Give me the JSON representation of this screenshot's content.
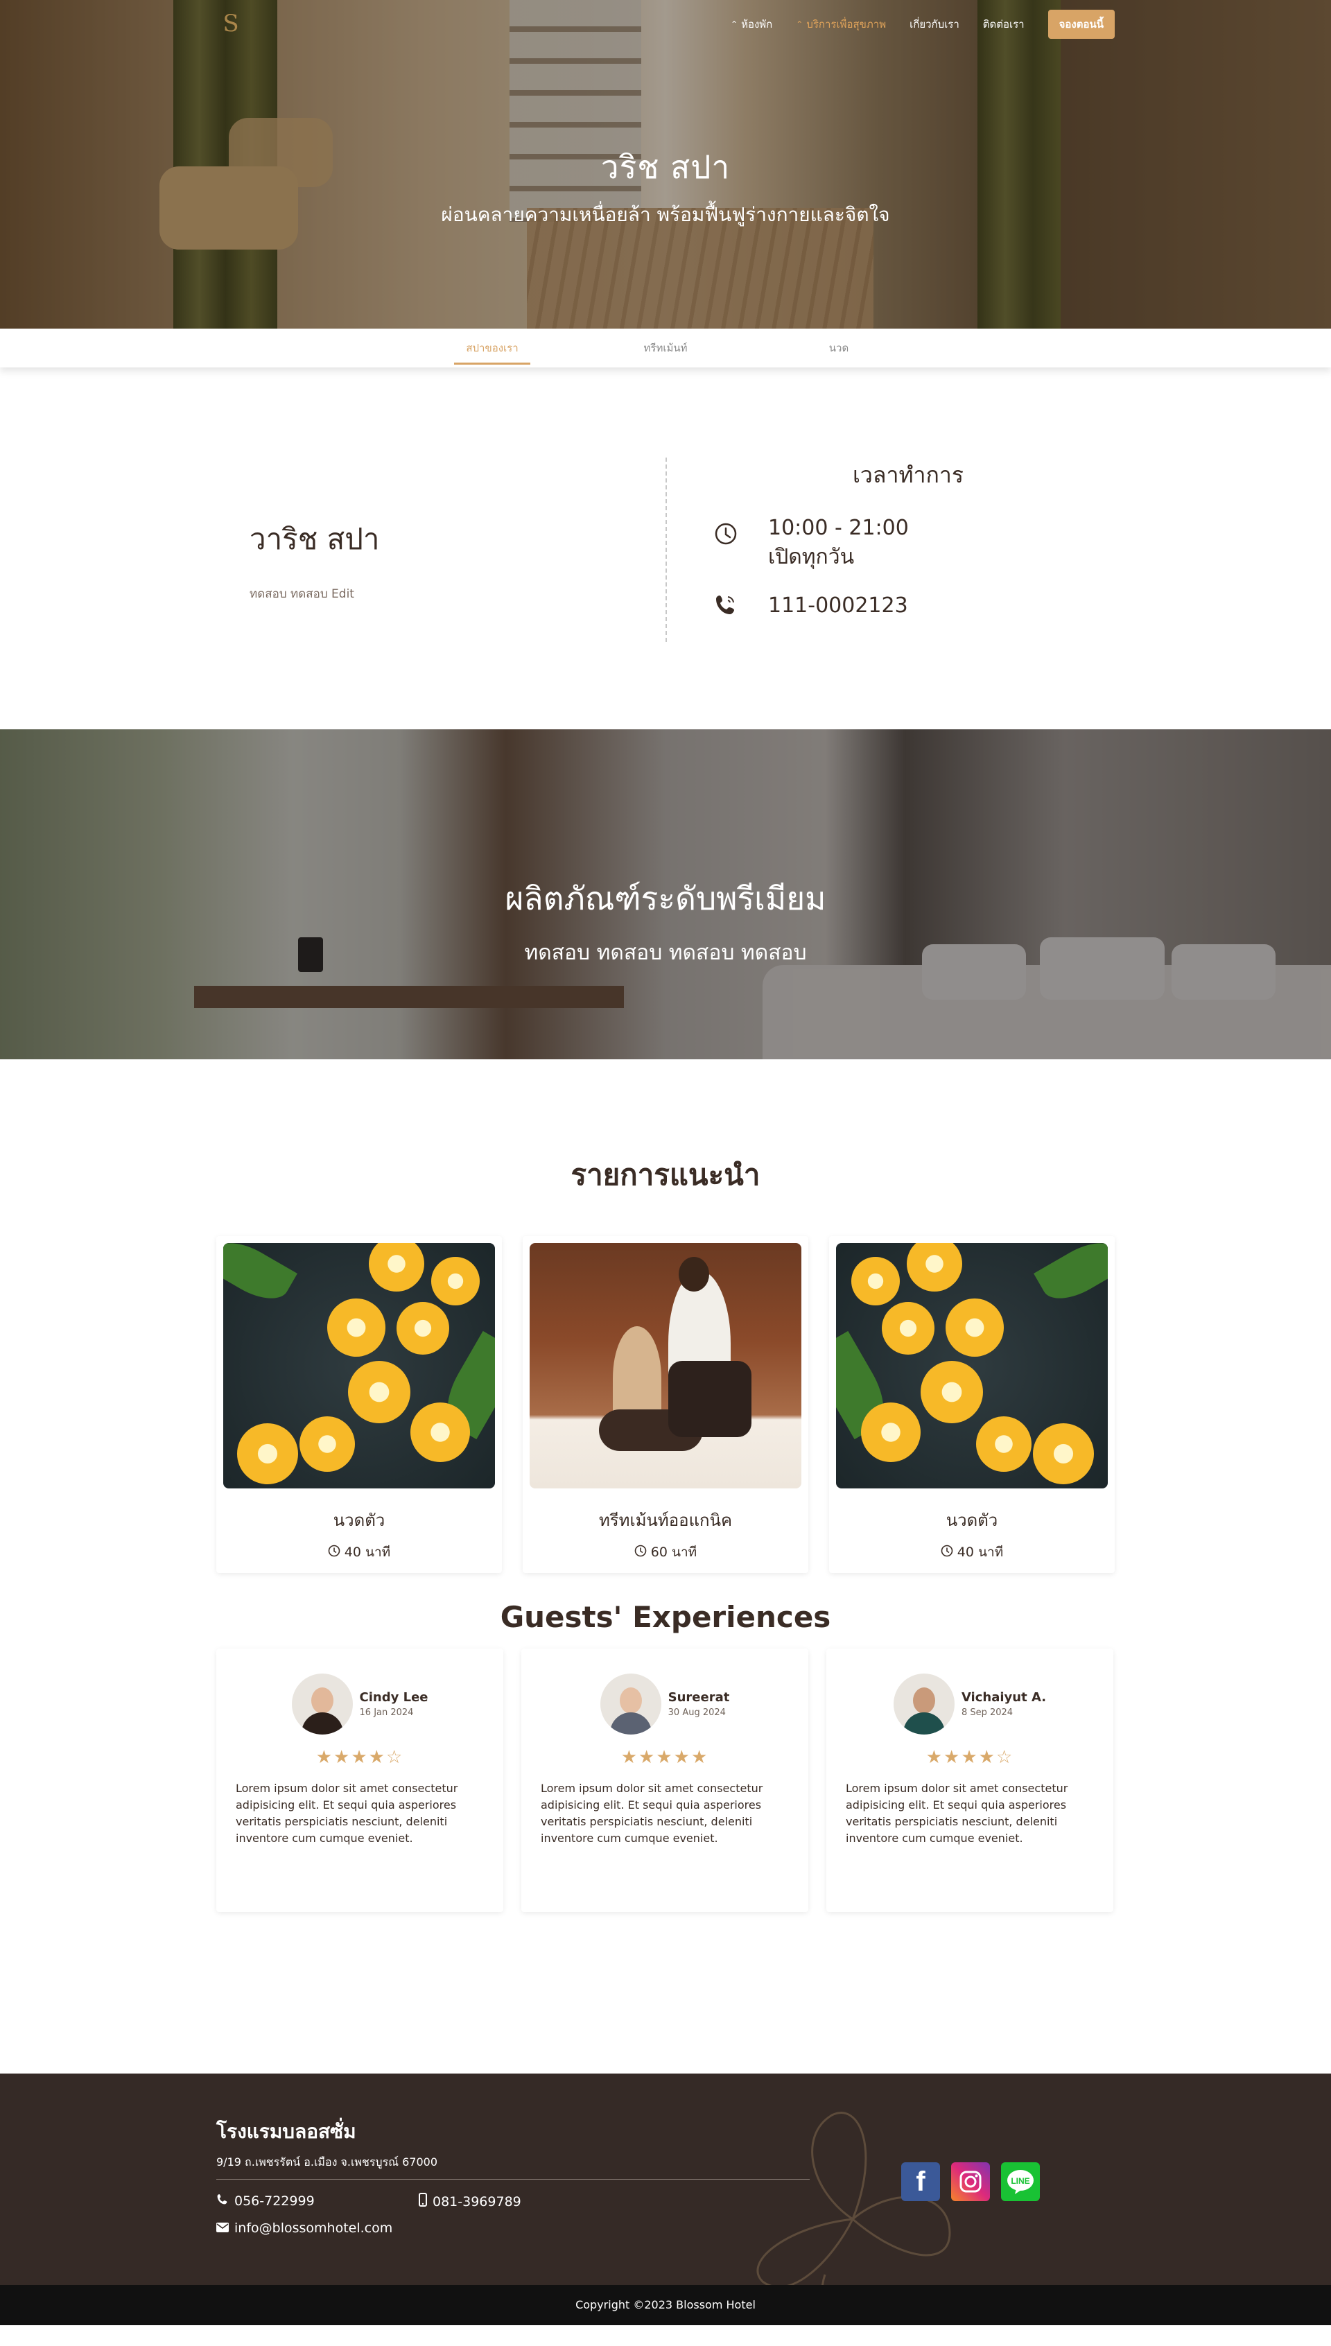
{
  "nav": {
    "items": [
      {
        "label": "ห้องพัก",
        "chevron": true
      },
      {
        "label": "บริการเพื่อสุขภาพ",
        "chevron": true,
        "active": true
      },
      {
        "label": "เกี่ยวกับเรา"
      },
      {
        "label": "ติดต่อเรา"
      }
    ],
    "book_label": "จองตอนนี้"
  },
  "hero": {
    "title": "วริช สปา",
    "subtitle": "ผ่อนคลายความเหนื่อยล้า พร้อมฟื้นฟูร่างกายและจิตใจ"
  },
  "tabs": [
    {
      "label": "สปาของเรา",
      "active": true
    },
    {
      "label": "ทรีทเม้นท์"
    },
    {
      "label": "นวด"
    }
  ],
  "info": {
    "name": "วาริช สปา",
    "description": "ทดสอบ ทดสอบ Edit",
    "hours_title": "เวลาทำการ",
    "hours": "10:00 - 21:00",
    "days": "เปิดทุกวัน",
    "phone": "111-0002123"
  },
  "banner": {
    "title": "ผลิตภัณฑ์ระดับพรีเมียม",
    "subtitle": "ทดสอบ ทดสอบ ทดสอบ ทดสอบ"
  },
  "recommended": {
    "title": "รายการแนะนำ",
    "items": [
      {
        "name": "นวดตัว",
        "duration": "40 นาที"
      },
      {
        "name": "ทรีทเม้นท์ออแกนิค",
        "duration": "60 นาที"
      },
      {
        "name": "นวดตัว",
        "duration": "40 นาที"
      }
    ]
  },
  "reviews": {
    "title": "Guests' Experiences",
    "items": [
      {
        "name": "Cindy Lee",
        "date": "16 Jan 2024",
        "rating": 4,
        "stars": "★★★★☆",
        "text": "Lorem ipsum dolor sit amet consectetur adipisicing elit. Et sequi quia asperiores veritatis perspiciatis nesciunt, deleniti inventore cum cumque eveniet."
      },
      {
        "name": "Sureerat",
        "date": "30 Aug 2024",
        "rating": 5,
        "stars": "★★★★★",
        "text": "Lorem ipsum dolor sit amet consectetur adipisicing elit. Et sequi quia asperiores veritatis perspiciatis nesciunt, deleniti inventore cum cumque eveniet."
      },
      {
        "name": "Vichaiyut A.",
        "date": "8 Sep 2024",
        "rating": 4,
        "stars": "★★★★☆",
        "text": "Lorem ipsum dolor sit amet consectetur adipisicing elit. Et sequi quia asperiores veritatis perspiciatis nesciunt, deleniti inventore cum cumque eveniet."
      }
    ]
  },
  "footer": {
    "hotel_name": "โรงแรมบลอสซั่ม",
    "address": "9/19 ถ.เพชรรัตน์ อ.เมือง จ.เพชรบูรณ์ 67000",
    "phone": "056-722999",
    "mobile": "081-3969789",
    "email": "info@blossomhotel.com",
    "socials": [
      "facebook-icon",
      "instagram-icon",
      "line-icon"
    ],
    "copyright": "Copyright ©2023 Blossom Hotel"
  },
  "colors": {
    "accent": "#d8a466",
    "text_dark": "#3a2c25",
    "footer_bg": "#352a26",
    "copyright_bg": "#111111"
  }
}
